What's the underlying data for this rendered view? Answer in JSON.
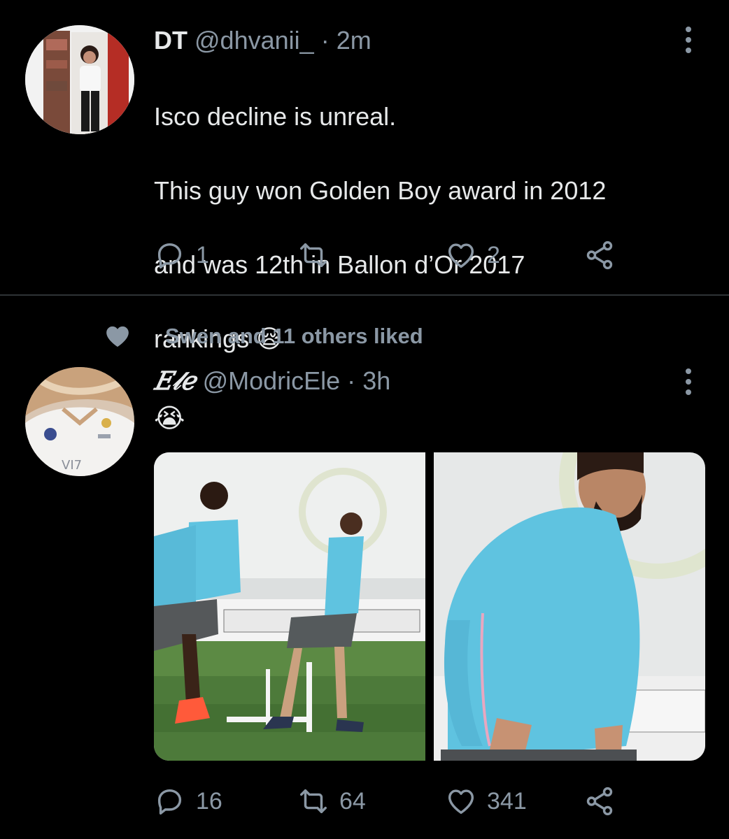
{
  "tweets": [
    {
      "name": "DT",
      "handle": "@dhvanii_",
      "separator": "·",
      "time": "2m",
      "text_lines": [
        "Isco decline is unreal.",
        "This guy won Golden Boy award in 2012",
        "and was 12th in Ballon d’Or 2017",
        "rankings 😪"
      ],
      "replies": "1",
      "retweets": "",
      "likes": "2"
    },
    {
      "social_context": "Swen and 11 others liked",
      "name": "𝐸𝓁𝑒",
      "handle": "@ModricEle",
      "separator": "·",
      "time": "3h",
      "text": "😭",
      "replies": "16",
      "retweets": "64",
      "likes": "341"
    }
  ],
  "icons": {
    "more": "more-vertical-icon",
    "reply": "reply-icon",
    "retweet": "retweet-icon",
    "like": "heart-icon",
    "share": "share-icon",
    "liked": "heart-filled-icon"
  },
  "colors": {
    "background": "#000000",
    "text": "#e7e9ea",
    "secondary": "#8b98a5",
    "divider": "#2f3336",
    "jersey_blue": "#5fc3e0"
  }
}
